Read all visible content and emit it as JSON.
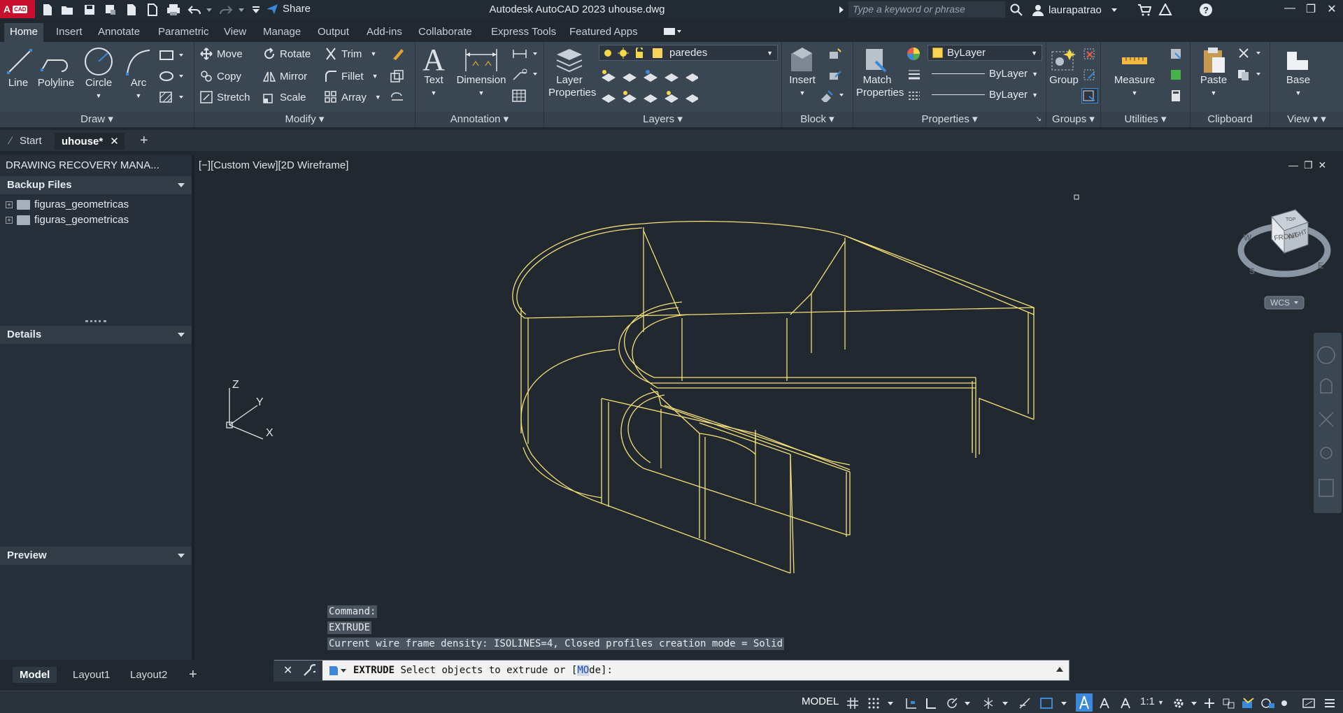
{
  "app": {
    "logo_text": "A",
    "logo_badge": "CAD",
    "title": "Autodesk AutoCAD 2023   uhouse.dwg",
    "share_label": "Share",
    "search_placeholder": "Type a keyword or phrase",
    "user": "laurapatrao"
  },
  "ribbon_tabs": [
    "Home",
    "Insert",
    "Annotate",
    "Parametric",
    "View",
    "Manage",
    "Output",
    "Add-ins",
    "Collaborate",
    "Express Tools",
    "Featured Apps"
  ],
  "ribbon": {
    "draw": {
      "title": "Draw",
      "line": "Line",
      "polyline": "Polyline",
      "circle": "Circle",
      "arc": "Arc"
    },
    "modify": {
      "title": "Modify",
      "move": "Move",
      "rotate": "Rotate",
      "trim": "Trim",
      "copy": "Copy",
      "mirror": "Mirror",
      "fillet": "Fillet",
      "stretch": "Stretch",
      "scale": "Scale",
      "array": "Array"
    },
    "annotation": {
      "title": "Annotation",
      "text": "Text",
      "dimension": "Dimension"
    },
    "layers": {
      "title": "Layers",
      "layer_properties_1": "Layer",
      "layer_properties_2": "Properties",
      "current_layer": "paredes"
    },
    "block": {
      "title": "Block",
      "insert": "Insert"
    },
    "properties": {
      "title": "Properties",
      "match_1": "Match",
      "match_2": "Properties",
      "color": "ByLayer",
      "linetype": "ByLayer",
      "lineweight": "ByLayer"
    },
    "groups": {
      "title": "Groups",
      "group": "Group"
    },
    "utilities": {
      "title": "Utilities",
      "measure": "Measure"
    },
    "clipboard": {
      "title": "Clipboard",
      "paste": "Paste"
    },
    "view": {
      "title": "View",
      "base": "Base"
    }
  },
  "file_tabs": {
    "start": "Start",
    "active": "uhouse*"
  },
  "palette": {
    "title": "DRAWING RECOVERY MANA...",
    "backup_files": "Backup Files",
    "files": [
      "figuras_geometricas",
      "figuras_geometricas"
    ],
    "details": "Details",
    "preview": "Preview"
  },
  "viewport": {
    "label": "[−][Custom View][2D Wireframe]",
    "viewcube": {
      "top": "TOP",
      "front": "FRONT",
      "right": "RIGHT",
      "w": "W",
      "s": "S",
      "e": "E",
      "wcs": "WCS"
    },
    "ucs": {
      "x": "X",
      "y": "Y",
      "z": "Z"
    }
  },
  "command": {
    "history": [
      "Command:",
      "EXTRUDE",
      "Current wire frame density:  ISOLINES=4, Closed profiles creation mode = Solid"
    ],
    "prompt_cmd": "EXTRUDE",
    "prompt_text": " Select objects to extrude or [",
    "prompt_option": "MO",
    "prompt_option_rest": "de",
    "prompt_end": "]:"
  },
  "layout_tabs": [
    "Model",
    "Layout1",
    "Layout2"
  ],
  "status": {
    "model": "MODEL",
    "scale": "1:1"
  },
  "colors": {
    "accent": "#3b8ad9",
    "wire": "#f5e07a",
    "logo": "#c8102e"
  }
}
